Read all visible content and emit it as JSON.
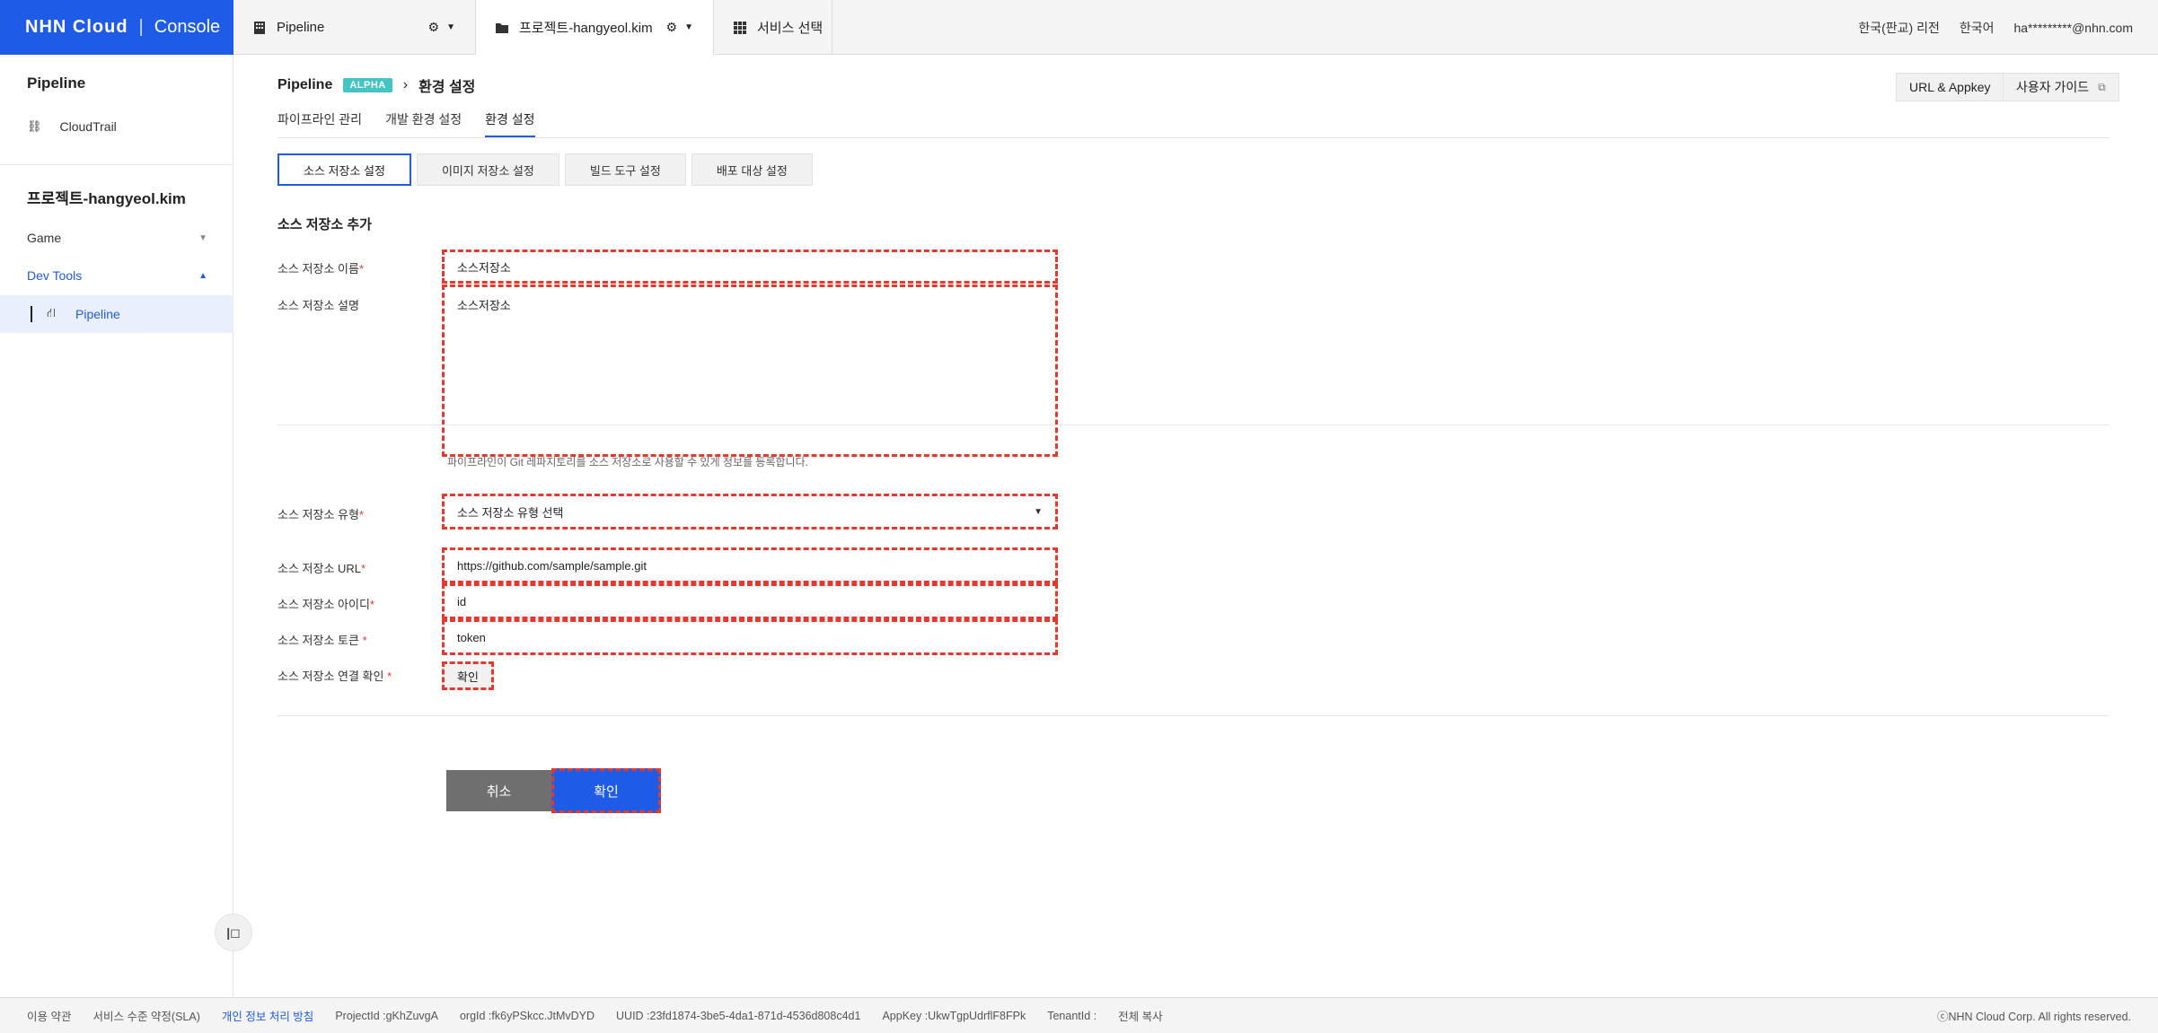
{
  "topbar": {
    "logo_brand": "NHN Cloud",
    "logo_sep": "|",
    "logo_console": "Console",
    "tab_pipeline": "Pipeline",
    "tab_project": "프로젝트-hangyeol.kim",
    "tab_service": "서비스 선택",
    "region": "한국(판교) 리전",
    "language": "한국어",
    "user": "ha*********@nhn.com"
  },
  "sidebar": {
    "org_title": "Pipeline",
    "cloudtrail": "CloudTrail",
    "project_title": "프로젝트-hangyeol.kim",
    "game": "Game",
    "devtools": "Dev Tools",
    "pipeline": "Pipeline"
  },
  "header": {
    "breadcrumb_root": "Pipeline",
    "badge": "ALPHA",
    "breadcrumb_current": "환경 설정",
    "url_appkey": "URL & Appkey",
    "user_guide": "사용자 가이드"
  },
  "subnav": [
    "파이프라인 관리",
    "개발 환경 설정",
    "환경 설정"
  ],
  "tabs": [
    "소스 저장소 설정",
    "이미지 저장소 설정",
    "빌드 도구 설정",
    "배포 대상 설정"
  ],
  "form": {
    "section_title": "소스 저장소 추가",
    "name_label": "소스 저장소 이름",
    "name_value": "소스저장소",
    "desc_label": "소스 저장소 설명",
    "desc_value": "소스저장소",
    "help_text": "파이프라인이 Git 레파지토리를 소스 저장소로 사용할 수 있게 정보를 등록합니다.",
    "type_label": "소스 저장소 유형",
    "type_value": "소스 저장소 유형 선택",
    "url_label": "소스 저장소 URL",
    "url_value": "https://github.com/sample/sample.git",
    "id_label": "소스 저장소 아이디",
    "id_value": "id",
    "token_label": "소스 저장소 토큰 ",
    "token_value": "token",
    "connect_label": "소스 저장소 연결 확인 ",
    "connect_button": "확인",
    "required_mark": "*",
    "cancel": "취소",
    "confirm": "확인"
  },
  "footer": {
    "terms": "이용 약관",
    "sla": "서비스 수준 약정(SLA)",
    "privacy": "개인 정보 처리 방침",
    "project_id": "ProjectId :gKhZuvgA",
    "org_id": "orgId :fk6yPSkcc.JtMvDYD",
    "uuid": "UUID :23fd1874-3be5-4da1-871d-4536d808c4d1",
    "appkey": "AppKey :UkwTgpUdrflF8FPk",
    "tenant": "TenantId :",
    "copy_all": "전체 복사",
    "copyright": "ⓒNHN Cloud Corp. All rights reserved."
  }
}
